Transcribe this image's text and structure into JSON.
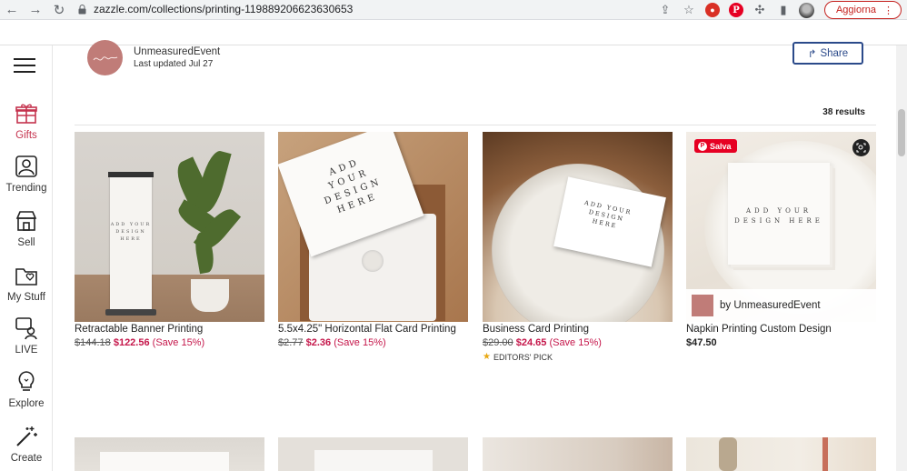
{
  "browser": {
    "url": "zazzle.com/collections/printing-119889206623630653",
    "update_label": "Aggiorna",
    "icons": [
      "back-icon",
      "forward-icon",
      "reload-icon",
      "lock-icon",
      "share-page-icon",
      "star-icon",
      "extension-red-icon",
      "pinterest-icon",
      "puzzle-icon",
      "sidebar-icon",
      "profile-avatar",
      "kebab-menu-icon"
    ]
  },
  "rail": {
    "items": [
      {
        "label": "Gifts",
        "icon": "gift-icon"
      },
      {
        "label": "Trending",
        "icon": "trending-icon"
      },
      {
        "label": "Sell",
        "icon": "store-icon"
      },
      {
        "label": "My Stuff",
        "icon": "folder-heart-icon"
      },
      {
        "label": "LIVE",
        "icon": "live-chat-icon"
      },
      {
        "label": "Explore",
        "icon": "lightbulb-icon"
      },
      {
        "label": "Create",
        "icon": "magic-wand-icon"
      }
    ]
  },
  "collection": {
    "creator": "UnmeasuredEvent",
    "updated": "Last updated Jul 27",
    "share_label": "Share",
    "results": "38 results"
  },
  "products": [
    {
      "title": "Retractable Banner Printing",
      "old_price": "$144.18",
      "price": "$122.56",
      "save": "(Save 15%)"
    },
    {
      "title": "5.5x4.25\" Horizontal Flat Card Printing",
      "old_price": "$2.77",
      "price": "$2.36",
      "save": "(Save 15%)"
    },
    {
      "title": "Business Card Printing",
      "old_price": "$29.00",
      "price": "$24.65",
      "save": "(Save 15%)",
      "badge": "EDITORS' PICK"
    },
    {
      "title": "Napkin Printing Custom Design",
      "price": "$47.50",
      "pin_label": "Salva",
      "byline": "by UnmeasuredEvent"
    }
  ],
  "mock_text": {
    "add_your_design_here": "ADD YOUR DESIGN HERE"
  },
  "colors": {
    "sale": "#c5164a",
    "accent_rail": "#c5334e",
    "share_border": "#2b4a8a",
    "pinterest": "#e60023"
  }
}
